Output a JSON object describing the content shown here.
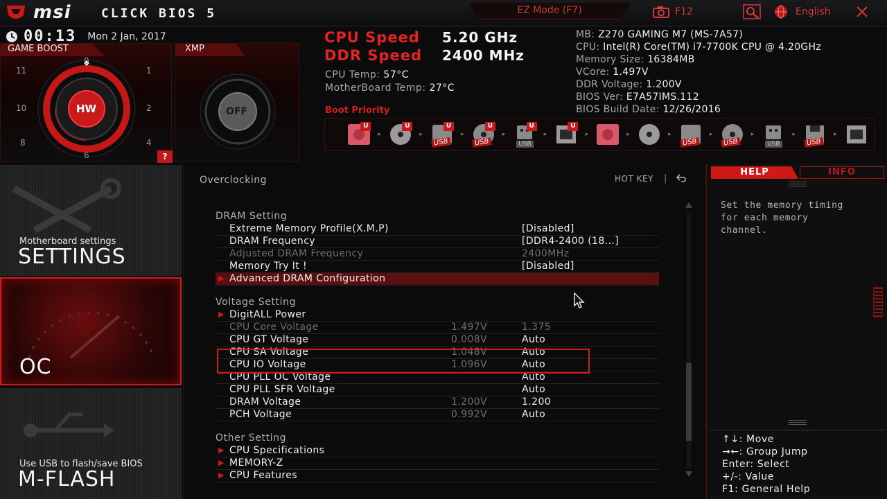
{
  "topbar": {
    "brand": "msi",
    "product": "CLICK BIOS 5",
    "ez_mode": "EZ Mode (F7)",
    "screenshot_key": "F12",
    "language": "English"
  },
  "status": {
    "clock": "00:13",
    "date": "Mon  2 Jan, 2017"
  },
  "game_boost": {
    "title": "GAME BOOST",
    "center_label": "HW",
    "numbers": [
      "0",
      "1",
      "2",
      "4",
      "6",
      "8",
      "10",
      "11"
    ],
    "help": "?"
  },
  "xmp": {
    "title": "XMP",
    "state": "OFF"
  },
  "speeds": {
    "cpu_label": "CPU Speed",
    "cpu_value": "5.20 GHz",
    "ddr_label": "DDR Speed",
    "ddr_value": "2400 MHz",
    "cpu_temp_label": "CPU Temp:",
    "cpu_temp": "57°C",
    "mb_temp_label": "MotherBoard Temp:",
    "mb_temp": "27°C"
  },
  "sysinfo": [
    {
      "label": "MB:",
      "value": "Z270 GAMING M7 (MS-7A57)"
    },
    {
      "label": "CPU:",
      "value": "Intel(R) Core(TM) i7-7700K CPU @ 4.20GHz"
    },
    {
      "label": "Memory Size:",
      "value": "16384MB"
    },
    {
      "label": "VCore:",
      "value": "1.497V"
    },
    {
      "label": "DDR Voltage:",
      "value": "1.200V"
    },
    {
      "label": "BIOS Ver:",
      "value": "E7A57IMS.112"
    },
    {
      "label": "BIOS Build Date:",
      "value": "12/26/2016"
    }
  ],
  "boot": {
    "title": "Boot Priority",
    "usb_text": "USB",
    "u_text": "U"
  },
  "nav": {
    "settings_sub": "Motherboard settings",
    "settings": "SETTINGS",
    "oc": "OC",
    "mflash_sub": "Use USB to flash/save BIOS",
    "mflash": "M-FLASH"
  },
  "center": {
    "breadcrumb": "Overclocking",
    "hotkey": "HOT KEY",
    "hotkey_sep": "|",
    "sections": [
      {
        "title": "DRAM  Setting",
        "rows": [
          {
            "label": "Extreme Memory Profile(X.M.P)",
            "current": "",
            "value": "[Disabled]"
          },
          {
            "label": "DRAM Frequency",
            "current": "",
            "value": "[DDR4-2400 (18...]"
          },
          {
            "label": "Adjusted DRAM Frequency",
            "current": "",
            "value": "2400MHz"
          },
          {
            "label": "Memory Try It !",
            "current": "",
            "value": "[Disabled]"
          },
          {
            "label": "Advanced DRAM Configuration",
            "current": "",
            "value": ""
          }
        ]
      },
      {
        "title": "Voltage  Setting",
        "rows": [
          {
            "label": "DigitALL Power",
            "current": "",
            "value": ""
          },
          {
            "label": "CPU Core Voltage",
            "current": "1.497V",
            "value": "1.375"
          },
          {
            "label": "CPU GT Voltage",
            "current": "0.008V",
            "value": "Auto"
          },
          {
            "label": "CPU SA Voltage",
            "current": "1.048V",
            "value": "Auto"
          },
          {
            "label": "CPU IO Voltage",
            "current": "1.096V",
            "value": "Auto"
          },
          {
            "label": "CPU PLL OC Voltage",
            "current": "",
            "value": "Auto"
          },
          {
            "label": "CPU PLL SFR Voltage",
            "current": "",
            "value": "Auto"
          },
          {
            "label": "DRAM Voltage",
            "current": "1.200V",
            "value": "1.200"
          },
          {
            "label": "PCH Voltage",
            "current": "0.992V",
            "value": "Auto"
          }
        ]
      },
      {
        "title": "Other  Setting",
        "rows": [
          {
            "label": "CPU Specifications",
            "current": "",
            "value": ""
          },
          {
            "label": "MEMORY-Z",
            "current": "",
            "value": ""
          },
          {
            "label": "CPU Features",
            "current": "",
            "value": ""
          }
        ]
      }
    ]
  },
  "help_panel": {
    "tab_help": "HELP",
    "tab_info": "INFO",
    "text": "Set the memory timing for each memory channel.",
    "keys": [
      "↑↓: Move",
      "→←: Group Jump",
      "Enter: Select",
      "+/-: Value",
      "F1: General Help"
    ]
  },
  "colors": {
    "accent": "#d21c1c",
    "selected_row": "#5c0f10",
    "text": "#f0f0f0",
    "dim_text": "#6e6e6e"
  }
}
